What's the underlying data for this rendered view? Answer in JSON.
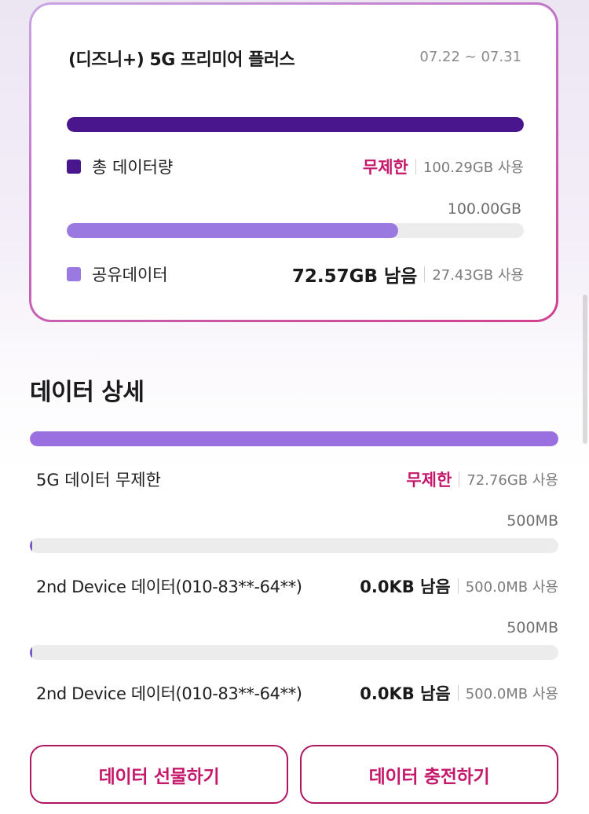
{
  "plan": {
    "title": "(디즈니+) 5G 프리미어 플러스",
    "period": "07.22 ~ 07.31",
    "total": {
      "label": "총 데이터량",
      "status": "무제한",
      "used": "100.29GB 사용",
      "fill_percent": 100,
      "color": "#4a168d"
    },
    "shared": {
      "capacity": "100.00GB",
      "label": "공유데이터",
      "remaining": "72.57GB 남음",
      "used": "27.43GB 사용",
      "fill_percent": 72.57,
      "color": "#9a7ae0"
    }
  },
  "detail": {
    "title": "데이터 상세",
    "items": [
      {
        "label": "5G 데이터 무제한",
        "status": "무제한",
        "used": "72.76GB 사용",
        "fill_percent": 100
      },
      {
        "capacity": "500MB",
        "label": "2nd Device 데이터(010-83**-64**)",
        "remaining": "0.0KB 남음",
        "used": "500.0MB 사용",
        "fill_percent": 0
      },
      {
        "capacity": "500MB",
        "label": "2nd Device 데이터(010-83**-64**)",
        "remaining": "0.0KB 남음",
        "used": "500.0MB 사용",
        "fill_percent": 0
      }
    ]
  },
  "buttons": {
    "gift": "데이터 선물하기",
    "charge": "데이터 충전하기"
  },
  "colors": {
    "accent_pink": "#c5186b",
    "deep_purple": "#4a168d",
    "light_purple": "#9a7ae0"
  }
}
